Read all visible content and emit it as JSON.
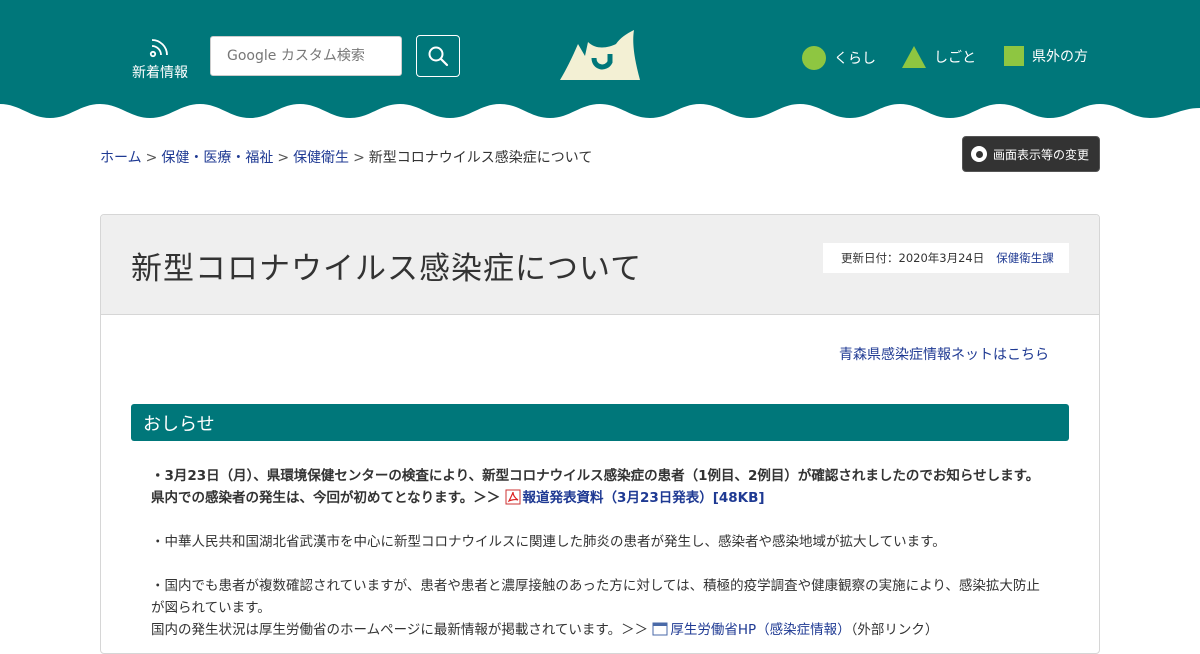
{
  "header": {
    "news_label": "新着情報",
    "search_placeholder": "Google カスタム検索",
    "categories": [
      {
        "label": "くらし",
        "icon": "circle-icon",
        "color": "#8ec641"
      },
      {
        "label": "しごと",
        "icon": "triangle-icon",
        "color": "#8ec641"
      },
      {
        "label": "県外の方",
        "icon": "square-icon",
        "color": "#8ec641"
      }
    ],
    "brand_color": "#00777a",
    "logo_color": "#f3f0d4"
  },
  "breadcrumb": {
    "items": [
      "ホーム",
      "保健・医療・福祉",
      "保健衛生"
    ],
    "current": "新型コロナウイルス感染症について",
    "separator": ">"
  },
  "display_button_label": "画面表示等の変更",
  "page": {
    "title": "新型コロナウイルス感染症について",
    "updated_label": "更新日付：2020年3月24日",
    "department": "保健衛生課",
    "external_link": "青森県感染症情報ネットはこちら",
    "section_heading": "おしらせ"
  },
  "notices": {
    "n1_text": "・3月23日（月）、県環境保健センターの検査により、新型コロナウイルス感染症の患者（1例目、2例目）が確認されましたのでお知らせします。県内での感染者の発生は、今回が初めてとなります。＞＞",
    "n1_link": "報道発表資料（3月23日発表）[48KB]",
    "n2_text": "・中華人民共和国湖北省武漢市を中心に新型コロナウイルスに関連した肺炎の患者が発生し、感染者や感染地域が拡大しています。",
    "n3_text": "・国内でも患者が複数確認されていますが、患者や患者と濃厚接触のあった方に対しては、積極的疫学調査や健康観察の実施により、感染拡大防止が図られています。",
    "n4_text": "国内の発生状況は厚生労働省のホームページに最新情報が掲載されています。＞＞",
    "n4_link": "厚生労働省HP（感染症情報）",
    "n4_suffix": "（外部リンク）"
  }
}
